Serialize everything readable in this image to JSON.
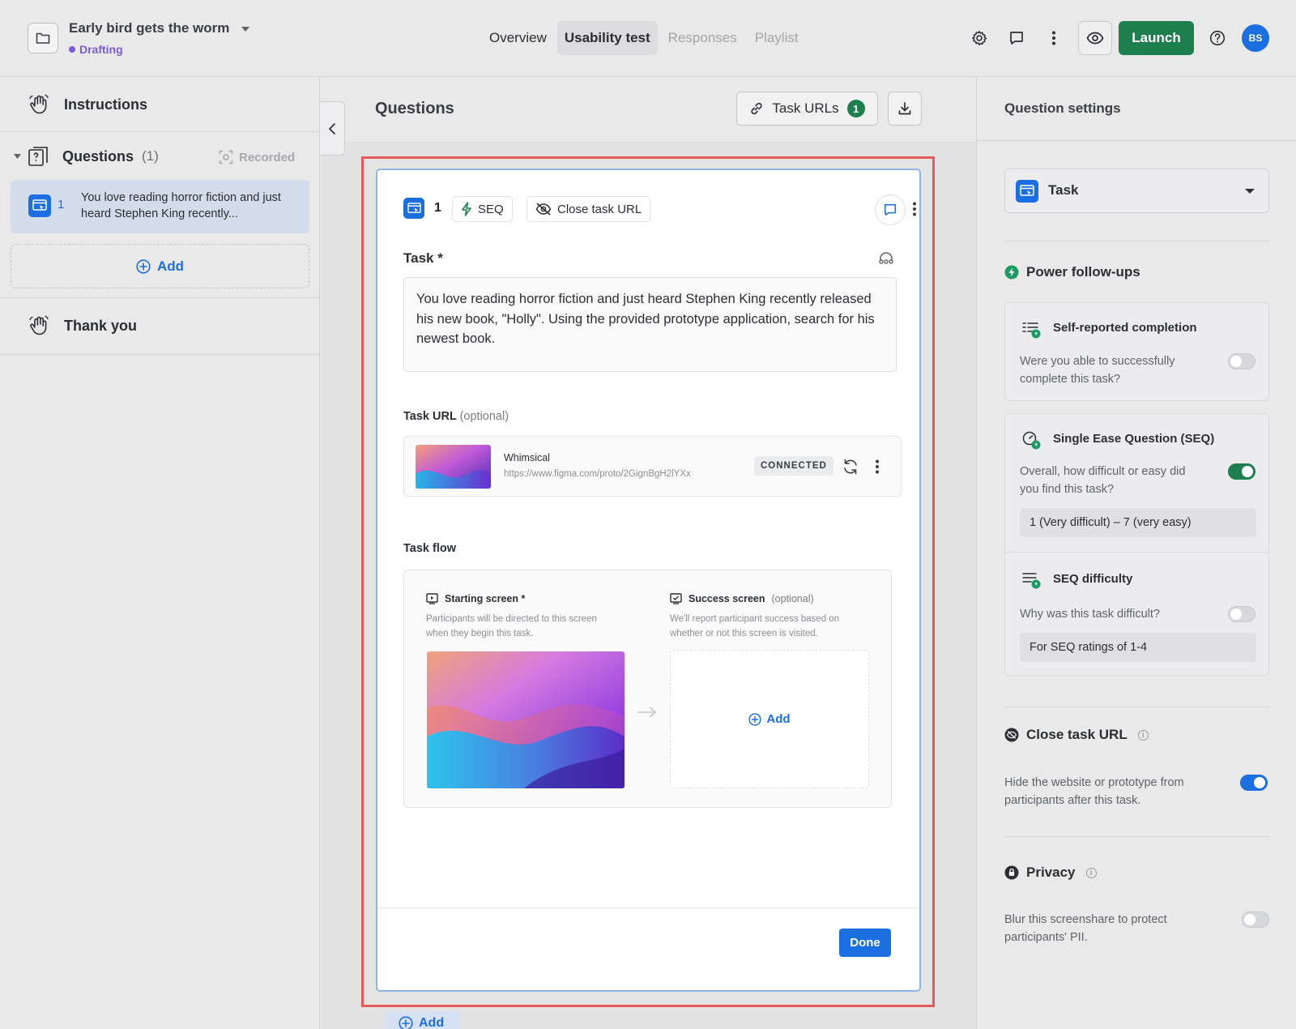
{
  "header": {
    "project_title": "Early bird gets the worm",
    "status": "Drafting",
    "tabs": [
      {
        "label": "Overview"
      },
      {
        "label": "Usability test"
      },
      {
        "label": "Responses"
      },
      {
        "label": "Playlist"
      }
    ],
    "launch_label": "Launch",
    "avatar_initials": "BS",
    "accent": "#1d7f4e"
  },
  "sidebar": {
    "instructions_label": "Instructions",
    "questions_label": "Questions",
    "questions_count": "(1)",
    "recorded_label": "Recorded",
    "question_item": {
      "number": "1",
      "text": "You love reading horror fiction and just heard Stephen King recently..."
    },
    "add_label": "Add",
    "thank_you_label": "Thank you"
  },
  "center": {
    "title": "Questions",
    "task_urls_label": "Task URLs",
    "task_urls_count": "1",
    "card": {
      "number": "1",
      "seq_label": "SEQ",
      "close_task_url_label": "Close task URL",
      "task_label": "Task *",
      "task_text": "You love reading horror fiction and just heard Stephen King recently released his new book, \"Holly\". Using the provided prototype application, search for his newest book.",
      "task_url_label": "Task URL",
      "task_url_optional": "(optional)",
      "url_name": "Whimsical",
      "url_href": "https://www.figma.com/proto/2GignBgH2lYXx",
      "connected_label": "CONNECTED",
      "task_flow_label": "Task flow",
      "starting_screen_label": "Starting screen *",
      "starting_screen_desc": "Participants will be directed to this screen when they begin this task.",
      "success_screen_label": "Success screen",
      "success_screen_optional": "(optional)",
      "success_screen_desc": "We'll report participant success based on whether or not this screen is visited.",
      "flow_add_label": "Add",
      "done_label": "Done"
    },
    "under_add_label": "Add"
  },
  "settings": {
    "title": "Question settings",
    "type_label": "Task",
    "power_followups_label": "Power follow-ups",
    "self_reported": {
      "title": "Self-reported completion",
      "desc": "Were you able to successfully complete this task?",
      "enabled": false
    },
    "seq": {
      "title": "Single Ease Question (SEQ)",
      "desc": "Overall, how difficult or easy did you find this task?",
      "scale": "1 (Very difficult) – 7 (very easy)",
      "enabled": true
    },
    "seq_difficulty": {
      "title": "SEQ difficulty",
      "desc": "Why was this task difficult?",
      "condition": "For SEQ ratings of 1-4",
      "enabled": false
    },
    "close_task_url": {
      "title": "Close task URL",
      "desc": "Hide the website or prototype from participants after this task.",
      "enabled": true
    },
    "privacy": {
      "title": "Privacy",
      "desc": "Blur this screenshare to protect participants' PII.",
      "enabled": false
    }
  }
}
